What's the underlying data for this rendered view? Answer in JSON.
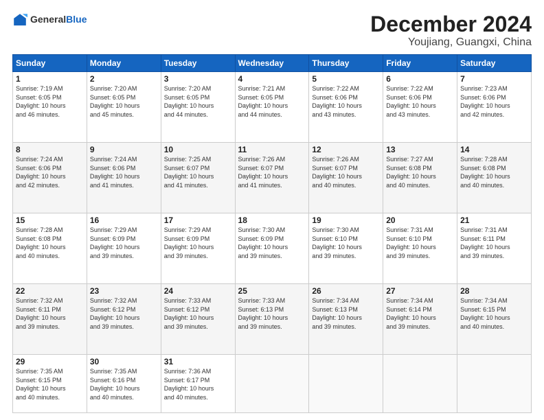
{
  "header": {
    "logo": {
      "general": "General",
      "blue": "Blue"
    },
    "title": "December 2024",
    "location": "Youjiang, Guangxi, China"
  },
  "calendar": {
    "days_of_week": [
      "Sunday",
      "Monday",
      "Tuesday",
      "Wednesday",
      "Thursday",
      "Friday",
      "Saturday"
    ],
    "weeks": [
      [
        {
          "day": "",
          "info": ""
        },
        {
          "day": "2",
          "info": "Sunrise: 7:20 AM\nSunset: 6:05 PM\nDaylight: 10 hours\nand 45 minutes."
        },
        {
          "day": "3",
          "info": "Sunrise: 7:20 AM\nSunset: 6:05 PM\nDaylight: 10 hours\nand 44 minutes."
        },
        {
          "day": "4",
          "info": "Sunrise: 7:21 AM\nSunset: 6:05 PM\nDaylight: 10 hours\nand 44 minutes."
        },
        {
          "day": "5",
          "info": "Sunrise: 7:22 AM\nSunset: 6:06 PM\nDaylight: 10 hours\nand 43 minutes."
        },
        {
          "day": "6",
          "info": "Sunrise: 7:22 AM\nSunset: 6:06 PM\nDaylight: 10 hours\nand 43 minutes."
        },
        {
          "day": "7",
          "info": "Sunrise: 7:23 AM\nSunset: 6:06 PM\nDaylight: 10 hours\nand 42 minutes."
        }
      ],
      [
        {
          "day": "8",
          "info": "Sunrise: 7:24 AM\nSunset: 6:06 PM\nDaylight: 10 hours\nand 42 minutes."
        },
        {
          "day": "9",
          "info": "Sunrise: 7:24 AM\nSunset: 6:06 PM\nDaylight: 10 hours\nand 41 minutes."
        },
        {
          "day": "10",
          "info": "Sunrise: 7:25 AM\nSunset: 6:07 PM\nDaylight: 10 hours\nand 41 minutes."
        },
        {
          "day": "11",
          "info": "Sunrise: 7:26 AM\nSunset: 6:07 PM\nDaylight: 10 hours\nand 41 minutes."
        },
        {
          "day": "12",
          "info": "Sunrise: 7:26 AM\nSunset: 6:07 PM\nDaylight: 10 hours\nand 40 minutes."
        },
        {
          "day": "13",
          "info": "Sunrise: 7:27 AM\nSunset: 6:08 PM\nDaylight: 10 hours\nand 40 minutes."
        },
        {
          "day": "14",
          "info": "Sunrise: 7:28 AM\nSunset: 6:08 PM\nDaylight: 10 hours\nand 40 minutes."
        }
      ],
      [
        {
          "day": "15",
          "info": "Sunrise: 7:28 AM\nSunset: 6:08 PM\nDaylight: 10 hours\nand 40 minutes."
        },
        {
          "day": "16",
          "info": "Sunrise: 7:29 AM\nSunset: 6:09 PM\nDaylight: 10 hours\nand 39 minutes."
        },
        {
          "day": "17",
          "info": "Sunrise: 7:29 AM\nSunset: 6:09 PM\nDaylight: 10 hours\nand 39 minutes."
        },
        {
          "day": "18",
          "info": "Sunrise: 7:30 AM\nSunset: 6:09 PM\nDaylight: 10 hours\nand 39 minutes."
        },
        {
          "day": "19",
          "info": "Sunrise: 7:30 AM\nSunset: 6:10 PM\nDaylight: 10 hours\nand 39 minutes."
        },
        {
          "day": "20",
          "info": "Sunrise: 7:31 AM\nSunset: 6:10 PM\nDaylight: 10 hours\nand 39 minutes."
        },
        {
          "day": "21",
          "info": "Sunrise: 7:31 AM\nSunset: 6:11 PM\nDaylight: 10 hours\nand 39 minutes."
        }
      ],
      [
        {
          "day": "22",
          "info": "Sunrise: 7:32 AM\nSunset: 6:11 PM\nDaylight: 10 hours\nand 39 minutes."
        },
        {
          "day": "23",
          "info": "Sunrise: 7:32 AM\nSunset: 6:12 PM\nDaylight: 10 hours\nand 39 minutes."
        },
        {
          "day": "24",
          "info": "Sunrise: 7:33 AM\nSunset: 6:12 PM\nDaylight: 10 hours\nand 39 minutes."
        },
        {
          "day": "25",
          "info": "Sunrise: 7:33 AM\nSunset: 6:13 PM\nDaylight: 10 hours\nand 39 minutes."
        },
        {
          "day": "26",
          "info": "Sunrise: 7:34 AM\nSunset: 6:13 PM\nDaylight: 10 hours\nand 39 minutes."
        },
        {
          "day": "27",
          "info": "Sunrise: 7:34 AM\nSunset: 6:14 PM\nDaylight: 10 hours\nand 39 minutes."
        },
        {
          "day": "28",
          "info": "Sunrise: 7:34 AM\nSunset: 6:15 PM\nDaylight: 10 hours\nand 40 minutes."
        }
      ],
      [
        {
          "day": "29",
          "info": "Sunrise: 7:35 AM\nSunset: 6:15 PM\nDaylight: 10 hours\nand 40 minutes."
        },
        {
          "day": "30",
          "info": "Sunrise: 7:35 AM\nSunset: 6:16 PM\nDaylight: 10 hours\nand 40 minutes."
        },
        {
          "day": "31",
          "info": "Sunrise: 7:36 AM\nSunset: 6:17 PM\nDaylight: 10 hours\nand 40 minutes."
        },
        {
          "day": "",
          "info": ""
        },
        {
          "day": "",
          "info": ""
        },
        {
          "day": "",
          "info": ""
        },
        {
          "day": "",
          "info": ""
        }
      ]
    ],
    "week1_day1": {
      "day": "1",
      "info": "Sunrise: 7:19 AM\nSunset: 6:05 PM\nDaylight: 10 hours\nand 46 minutes."
    }
  }
}
